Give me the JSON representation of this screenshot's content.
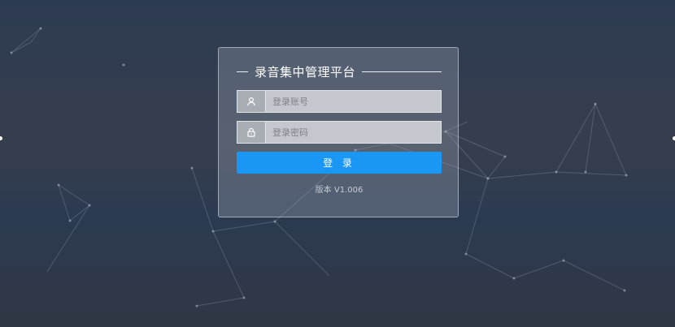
{
  "login": {
    "title": "录音集中管理平台",
    "username_placeholder": "登录账号",
    "password_placeholder": "登录密码",
    "login_label": "登 录",
    "version": "版本 V1.006"
  },
  "icons": {
    "username": "user-icon",
    "password": "lock-icon"
  },
  "colors": {
    "accent": "#1a97f5",
    "background": "#2f3a4d"
  }
}
